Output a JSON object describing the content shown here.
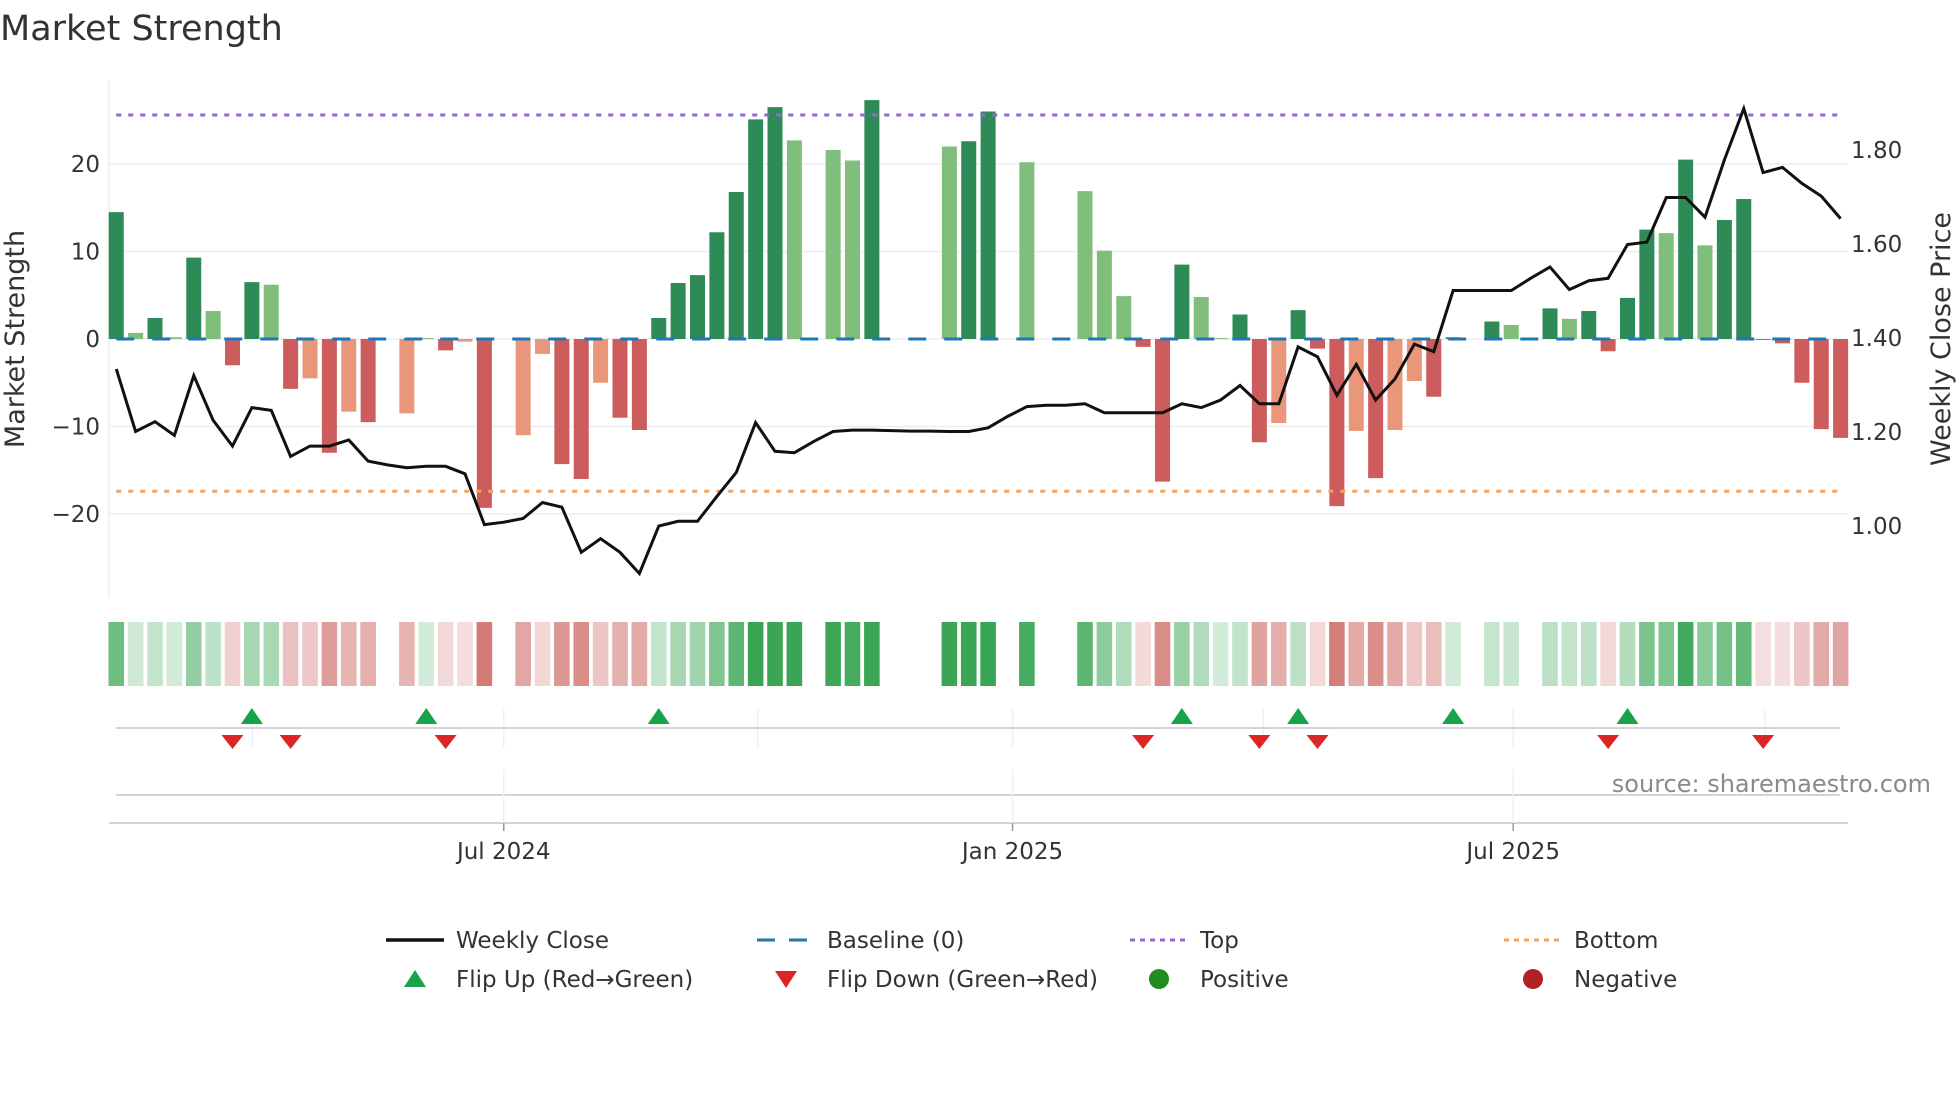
{
  "chart_data": {
    "type": "bar",
    "title": "Market Strength",
    "ylabel": "Market Strength",
    "ylabel_right": "Weekly Close Price",
    "ylim": [
      -29.6,
      29.5
    ],
    "ylim_right": [
      0.847,
      1.947
    ],
    "y_ticks": [
      {
        "value": -20,
        "label": "−20"
      },
      {
        "value": -10,
        "label": "−10"
      },
      {
        "value": 0,
        "label": "0"
      },
      {
        "value": 10,
        "label": "10"
      },
      {
        "value": 20,
        "label": "20"
      }
    ],
    "y_ticks_right": [
      {
        "value": 1.0,
        "label": "1.00"
      },
      {
        "value": 1.2,
        "label": "1.20"
      },
      {
        "value": 1.4,
        "label": "1.40"
      },
      {
        "value": 1.6,
        "label": "1.60"
      },
      {
        "value": 1.8,
        "label": "1.80"
      }
    ],
    "x_unit": "week index",
    "x_ticks": [
      {
        "week": 20.0,
        "label": "Jul 2024"
      },
      {
        "week": 46.26,
        "label": "Jan 2025"
      },
      {
        "week": 72.1,
        "label": "Jul 2025"
      }
    ],
    "x_minor_weeks": [
      7.03,
      20.0,
      33.1,
      46.26,
      59.2,
      72.1,
      85.1
    ],
    "grid": true,
    "top_level": 25.6,
    "bottom_level": -17.4,
    "baseline": 0,
    "strength": [
      14.5,
      0.7,
      2.4,
      0.2,
      9.3,
      3.2,
      -3.0,
      6.5,
      6.2,
      -5.7,
      -4.5,
      -13.0,
      -8.3,
      -9.5,
      null,
      -8.5,
      0.1,
      -1.3,
      -0.3,
      -19.3,
      null,
      -11.0,
      -1.7,
      -14.3,
      -16.0,
      -5.0,
      -9.0,
      -10.4,
      2.4,
      6.4,
      7.3,
      12.2,
      16.8,
      25.1,
      26.5,
      22.7,
      null,
      21.6,
      20.4,
      27.3,
      null,
      null,
      null,
      22.0,
      22.6,
      26.0,
      null,
      20.2,
      null,
      null,
      16.9,
      10.1,
      4.9,
      -0.9,
      -16.3,
      8.5,
      4.8,
      0.1,
      2.8,
      -11.8,
      -9.6,
      3.3,
      -1.1,
      -19.1,
      -10.5,
      -15.9,
      -10.4,
      -4.8,
      -6.6,
      0.2,
      null,
      2.0,
      1.6,
      null,
      3.5,
      2.3,
      3.2,
      -1.4,
      4.7,
      12.5,
      12.1,
      20.5,
      10.7,
      13.6,
      16.0,
      -0.1,
      -0.5,
      -5.0,
      -10.3,
      -11.3
    ],
    "strength_shade": [
      "strong",
      "weak",
      "strong",
      "weak",
      "strong",
      "weak",
      "strong",
      "strong",
      "weak",
      "strong",
      "weak",
      "strong",
      "weak",
      "strong",
      null,
      "weak",
      "weak",
      "strong",
      "weak",
      "strong",
      null,
      "weak",
      "weak",
      "strong",
      "strong",
      "weak",
      "strong",
      "strong",
      "strong",
      "strong",
      "strong",
      "strong",
      "strong",
      "strong",
      "strong",
      "weak",
      null,
      "weak",
      "weak",
      "strong",
      null,
      null,
      null,
      "weak",
      "strong",
      "strong",
      null,
      "weak",
      null,
      null,
      "weak",
      "weak",
      "weak",
      "strong",
      "strong",
      "strong",
      "weak",
      "weak",
      "strong",
      "strong",
      "weak",
      "strong",
      "strong",
      "strong",
      "weak",
      "strong",
      "weak",
      "weak",
      "strong",
      "strong",
      null,
      "strong",
      "weak",
      null,
      "strong",
      "weak",
      "strong",
      "strong",
      "strong",
      "strong",
      "weak",
      "strong",
      "weak",
      "strong",
      "strong",
      "strong",
      "strong",
      "strong",
      "strong",
      "strong"
    ],
    "weekly_close": [
      1.334,
      1.201,
      1.222,
      1.193,
      1.32,
      1.225,
      1.17,
      1.252,
      1.246,
      1.148,
      1.17,
      1.17,
      1.183,
      1.138,
      1.13,
      1.124,
      1.127,
      1.127,
      1.111,
      1.003,
      1.008,
      1.016,
      1.05,
      1.04,
      0.944,
      0.973,
      0.944,
      0.899,
      1.0,
      1.01,
      1.01,
      1.063,
      1.114,
      1.22,
      1.159,
      1.156,
      1.18,
      1.201,
      1.204,
      1.204,
      1.203,
      1.202,
      1.202,
      1.201,
      1.201,
      1.209,
      1.233,
      1.254,
      1.257,
      1.257,
      1.26,
      1.241,
      1.241,
      1.241,
      1.241,
      1.26,
      1.252,
      1.268,
      1.299,
      1.26,
      1.26,
      1.381,
      1.36,
      1.278,
      1.344,
      1.268,
      1.313,
      1.387,
      1.371,
      1.501,
      1.501,
      1.501,
      1.501,
      1.527,
      1.551,
      1.503,
      1.522,
      1.527,
      1.599,
      1.604,
      1.699,
      1.699,
      1.657,
      1.779,
      1.888,
      1.752,
      1.763,
      1.729,
      1.702,
      1.654
    ],
    "flip_up_weeks": [
      7,
      16,
      28,
      55,
      61,
      69,
      78
    ],
    "flip_down_weeks": [
      6,
      9,
      17,
      53,
      59,
      62,
      77,
      85
    ],
    "legend": [
      {
        "key": "weekly_close",
        "label": "Weekly Close"
      },
      {
        "key": "baseline",
        "label": "Baseline (0)"
      },
      {
        "key": "top",
        "label": "Top"
      },
      {
        "key": "bottom",
        "label": "Bottom"
      },
      {
        "key": "flip_up",
        "label": "Flip Up (Red→Green)"
      },
      {
        "key": "flip_down",
        "label": "Flip Down (Green→Red)"
      },
      {
        "key": "positive",
        "label": "Positive"
      },
      {
        "key": "negative",
        "label": "Negative"
      }
    ],
    "legend_placement": "bottom",
    "source": "source: sharemaestro.com",
    "colors": {
      "pos_strong": "#2e8b57",
      "pos_weak": "#7fbf7b",
      "neg_strong": "#cd5c5c",
      "neg_weak": "#e9967a",
      "strip_pos": "#3aa655",
      "strip_neg": "#cf6f6a",
      "line": "#111111",
      "baseline": "#1f77b4",
      "top": "#9467d6",
      "bottom": "#f4a460",
      "flip_up": "#16a34a",
      "flip_down": "#dc2626",
      "positive": "#228b22",
      "negative": "#b22222",
      "grid": "#eceef2",
      "axis": "#d0d3d8"
    }
  }
}
